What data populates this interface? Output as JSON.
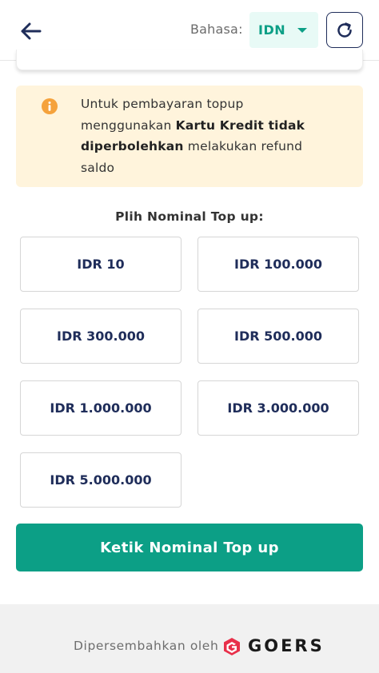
{
  "header": {
    "language_label": "Bahasa:",
    "language_value": "IDN"
  },
  "notice": {
    "text_1": "Untuk pembayaran topup menggunakan ",
    "bold_1": "Kartu Kredit tidak diperbolehkan",
    "text_2": " melakukan refund saldo"
  },
  "topup": {
    "title": "Plih Nominal Top up:",
    "options": [
      "IDR 10",
      "IDR 100.000",
      "IDR 300.000",
      "IDR 500.000",
      "IDR 1.000.000",
      "IDR 3.000.000",
      "IDR 5.000.000"
    ],
    "custom_button": "Ketik Nominal Top up"
  },
  "footer": {
    "powered_by": "Dipersembahkan oleh",
    "brand": "GOERS"
  },
  "colors": {
    "primary": "#0c9f86",
    "navy": "#1f2d5a",
    "notice_bg": "#fff4dc",
    "info_icon": "#f5a23c",
    "logo_red": "#e8304a"
  },
  "icons": {
    "back": "arrow-left-icon",
    "dropdown": "caret-down-icon",
    "refresh": "refresh-icon",
    "info": "info-icon",
    "brand": "goers-logo-icon"
  }
}
